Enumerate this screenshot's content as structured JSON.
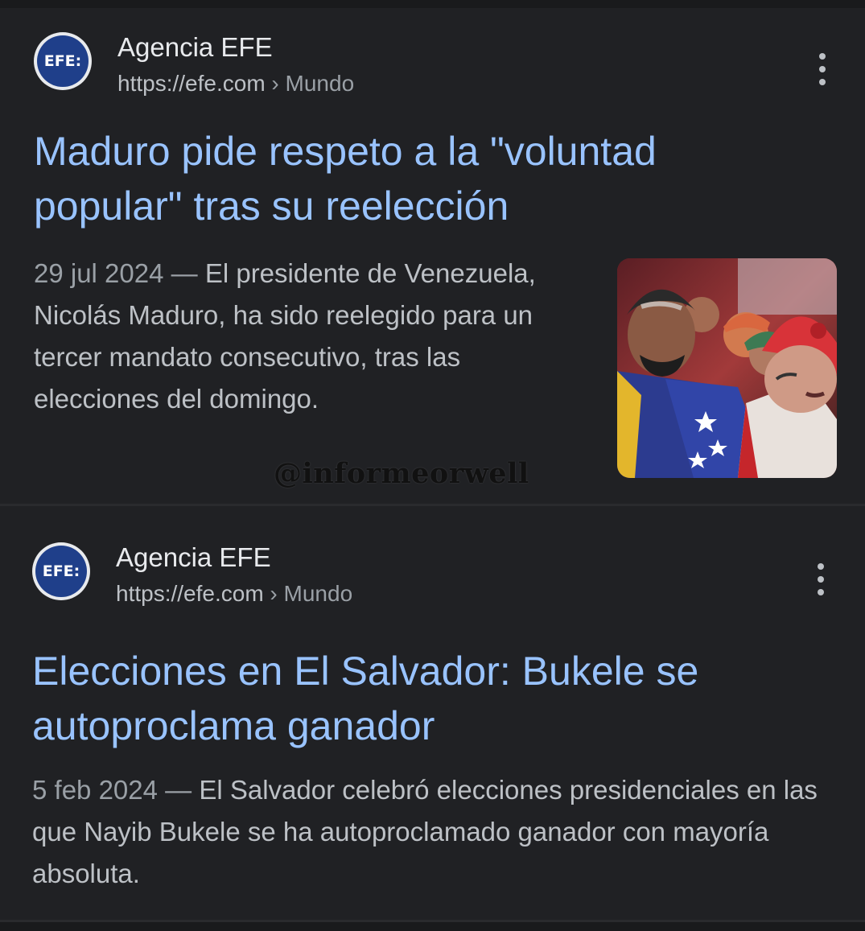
{
  "results": [
    {
      "logo_text": "EFE:",
      "site_name": "Agencia EFE",
      "url": "https://efe.com",
      "breadcrumb_sep": "›",
      "breadcrumb": "Mundo",
      "title": "Maduro pide respeto a la \"voluntad popular\" tras su reelección",
      "date": "29 jul 2024",
      "dash": "—",
      "snippet": "El presidente de Venezuela, Nicolás Maduro, ha sido reelegido para un tercer mandato consecutivo, tras las elecciones del domingo.",
      "has_thumbnail": true
    },
    {
      "logo_text": "EFE:",
      "site_name": "Agencia EFE",
      "url": "https://efe.com",
      "breadcrumb_sep": "›",
      "breadcrumb": "Mundo",
      "title": "Elecciones en El Salvador: Bukele se autoproclama ganador",
      "date": "5 feb 2024",
      "dash": "—",
      "snippet": "El Salvador celebró elecciones presidenciales en las que Nayib Bukele se ha autoproclamado ganador con mayoría absoluta.",
      "has_thumbnail": false
    }
  ],
  "watermark": "@informeorwell",
  "icons": {
    "more": "more-vert-icon",
    "logo": "efe-logo"
  },
  "colors": {
    "background": "#202124",
    "title_link": "#99c3ff",
    "text": "#bdc1c6",
    "site_name": "#e8eaed",
    "logo_blue": "#1f3f8a"
  }
}
